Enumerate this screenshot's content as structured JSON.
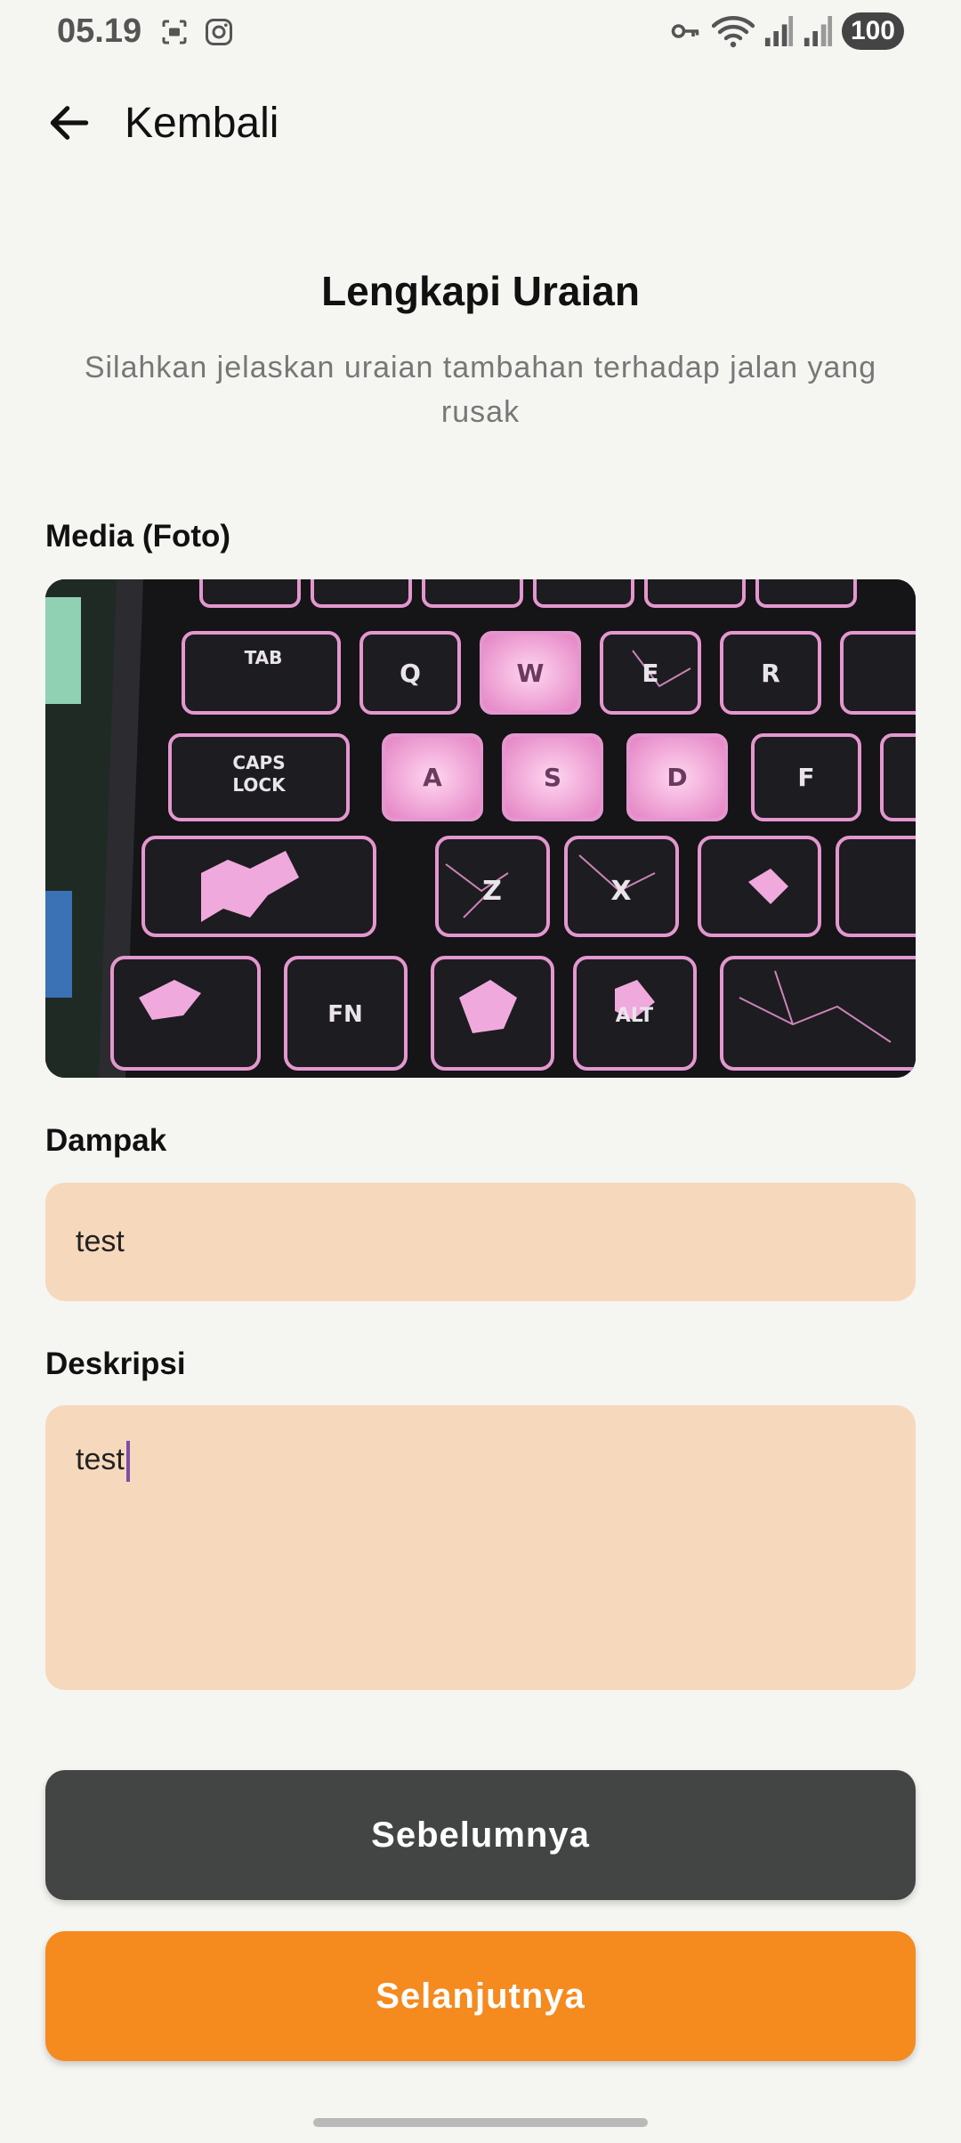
{
  "status_bar": {
    "time": "05.19",
    "battery": "100",
    "left_icons": [
      "screenshot-icon",
      "instagram-icon"
    ],
    "right_icons": [
      "vpn-key-icon",
      "wifi-icon",
      "signal-icon",
      "signal-icon"
    ]
  },
  "header": {
    "back_label": "Kembali"
  },
  "page": {
    "title": "Lengkapi Uraian",
    "subtitle": "Silahkan jelaskan uraian tambahan terhadap jalan yang rusak"
  },
  "media": {
    "label": "Media (Foto)"
  },
  "dampak": {
    "label": "Dampak",
    "value": "test"
  },
  "deskripsi": {
    "label": "Deskripsi",
    "value": "test"
  },
  "buttons": {
    "previous": "Sebelumnya",
    "next": "Selanjutnya"
  },
  "colors": {
    "background": "#f5f5f2",
    "input_fill": "#f6d8bc",
    "button_previous": "#434544",
    "button_next": "#f58a1f"
  }
}
